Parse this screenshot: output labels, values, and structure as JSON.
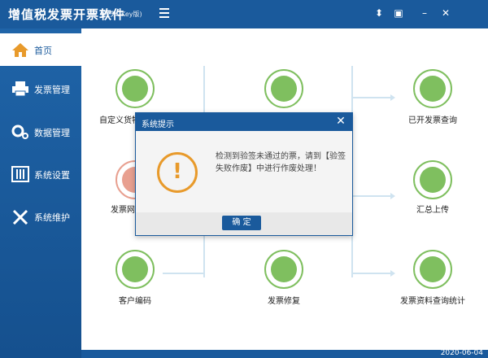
{
  "app": {
    "title": "增值税发票开票软件",
    "subtitle": "(税务UKey版)"
  },
  "window_controls": [
    "⬍",
    "▣",
    "–",
    "✕"
  ],
  "sidebar": {
    "items": [
      {
        "label": "首页",
        "icon": "home-icon",
        "active": true
      },
      {
        "label": "发票管理",
        "icon": "printer-icon",
        "active": false
      },
      {
        "label": "数据管理",
        "icon": "gear-icon",
        "active": false
      },
      {
        "label": "系统设置",
        "icon": "sliders-icon",
        "active": false
      },
      {
        "label": "系统维护",
        "icon": "tools-icon",
        "active": false
      }
    ]
  },
  "main": {
    "tiles": [
      {
        "label": "自定义货物",
        "icon": "goods-icon"
      },
      {
        "label": "",
        "icon": "settings-panel-icon"
      },
      {
        "label": "已开发票查询",
        "icon": "invoice-search-icon"
      },
      {
        "label": "发票网",
        "icon": "network-icon"
      },
      {
        "label": "汇总上传",
        "icon": "upload-icon"
      },
      {
        "label": "客户编码",
        "icon": "wallet-icon"
      },
      {
        "label": "发票修复",
        "icon": "repair-icon"
      },
      {
        "label": "发票资料查询统计",
        "icon": "stats-icon"
      }
    ]
  },
  "status": {
    "date": "2020-06-04"
  },
  "modal": {
    "title": "系统提示",
    "message": "检测到验签未通过的票，请到【验签失败作废】中进行作废处理！",
    "ok_label": "确  定"
  },
  "colors": {
    "primary": "#1a5a9c",
    "tile_green": "#7fbf5f",
    "warning": "#e89a2b",
    "line": "#cfe3f0"
  }
}
